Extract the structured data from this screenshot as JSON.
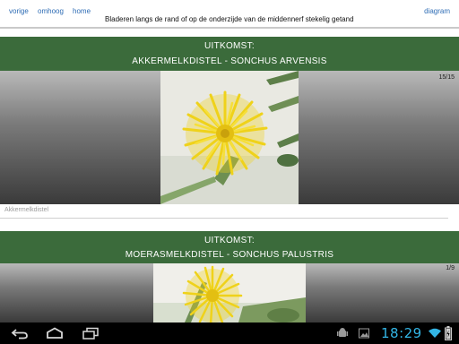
{
  "nav": {
    "prev_label": "vorige",
    "up_label": "omhoog",
    "home_label": "home",
    "diagram_label": "diagram",
    "question": "Bladeren langs de rand of op de onderzijde van de middennerf stekelig getand"
  },
  "results": [
    {
      "label": "UITKOMST:",
      "name": "AKKERMELKDISTEL - SONCHUS ARVENSIS",
      "counter": "15/15",
      "caption": "Akkermelkdistel"
    },
    {
      "label": "UITKOMST:",
      "name": "MOERASMELKDISTEL - SONCHUS PALUSTRIS",
      "counter": "1/9"
    }
  ],
  "status": {
    "time": "18:29"
  },
  "colors": {
    "header_green": "#3b6b3b",
    "link_blue": "#2f6db5",
    "clock_blue": "#33b5e5",
    "flower_yellow": "#f2d51f"
  },
  "icons": {
    "back": "back-icon",
    "home": "home-icon",
    "recents": "recent-apps-icon",
    "notification_app": "android-notification-icon",
    "notification_image": "image-notification-icon",
    "wifi": "wifi-icon",
    "battery": "battery-icon"
  }
}
